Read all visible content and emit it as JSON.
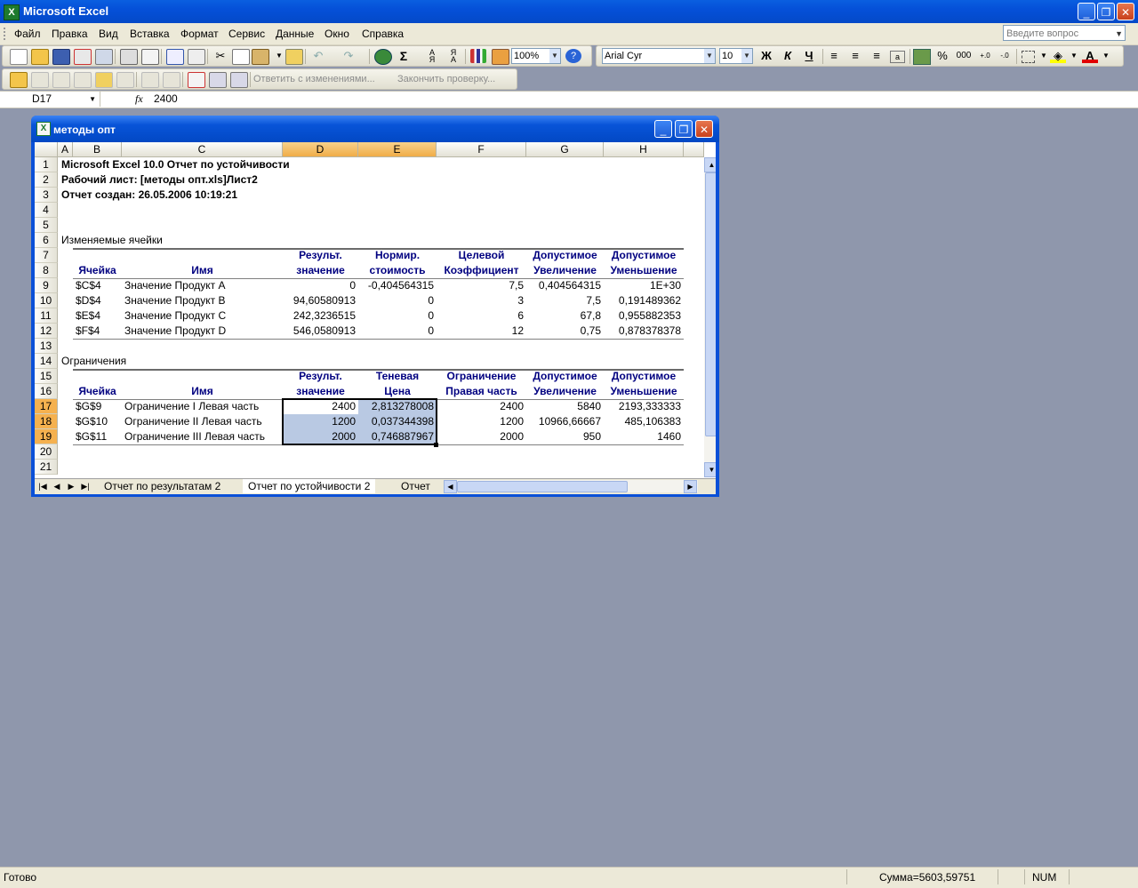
{
  "app": {
    "title": "Microsoft Excel"
  },
  "menu": [
    "Файл",
    "Правка",
    "Вид",
    "Вставка",
    "Формат",
    "Сервис",
    "Данные",
    "Окно",
    "Справка"
  ],
  "ask_placeholder": "Введите вопрос",
  "standard_toolbar": {
    "zoom": "100%"
  },
  "formatting_toolbar": {
    "font": "Arial Cyr",
    "size": "10",
    "bold": "Ж",
    "italic": "К",
    "underline": "Ч",
    "percent": "%",
    "thousands": "000"
  },
  "review_toolbar": {
    "reply_label": "Ответить с изменениями...",
    "end_label": "Закончить проверку..."
  },
  "formula_bar": {
    "name_box": "D17",
    "fx": "fx",
    "value": "2400"
  },
  "workbook": {
    "title": "методы опт",
    "columns": [
      "A",
      "B",
      "C",
      "D",
      "E",
      "F",
      "G",
      "H"
    ],
    "rows": [
      "1",
      "2",
      "3",
      "4",
      "5",
      "6",
      "7",
      "8",
      "9",
      "10",
      "11",
      "12",
      "13",
      "14",
      "15",
      "16",
      "17",
      "18",
      "19",
      "20",
      "21"
    ],
    "report": {
      "line1": "Microsoft Excel 10.0 Отчет по устойчивости",
      "line2": "Рабочий лист: [методы опт.xls]Лист2",
      "line3": "Отчет создан: 26.05.2006 10:19:21"
    },
    "changing_cells": {
      "section_title": "Изменяемые ячейки",
      "headers_top": [
        "",
        "",
        "Результ.",
        "Нормир.",
        "Целевой",
        "Допустимое",
        "Допустимое"
      ],
      "headers_bottom": [
        "Ячейка",
        "Имя",
        "значение",
        "стоимость",
        "Коэффициент",
        "Увеличение",
        "Уменьшение"
      ],
      "rows": [
        [
          "$C$4",
          "Значение Продукт A",
          "0",
          "-0,404564315",
          "7,5",
          "0,404564315",
          "1E+30"
        ],
        [
          "$D$4",
          "Значение Продукт B",
          "94,60580913",
          "0",
          "3",
          "7,5",
          "0,191489362"
        ],
        [
          "$E$4",
          "Значение Продукт C",
          "242,3236515",
          "0",
          "6",
          "67,8",
          "0,955882353"
        ],
        [
          "$F$4",
          "Значение Продукт D",
          "546,0580913",
          "0",
          "12",
          "0,75",
          "0,878378378"
        ]
      ]
    },
    "constraints": {
      "section_title": "Ограничения",
      "headers_top": [
        "",
        "",
        "Результ.",
        "Теневая",
        "Ограничение",
        "Допустимое",
        "Допустимое"
      ],
      "headers_bottom": [
        "Ячейка",
        "Имя",
        "значение",
        "Цена",
        "Правая часть",
        "Увеличение",
        "Уменьшение"
      ],
      "rows": [
        [
          "$G$9",
          "Ограничение I Левая часть",
          "2400",
          "2,813278008",
          "2400",
          "5840",
          "2193,333333"
        ],
        [
          "$G$10",
          "Ограничение II Левая часть",
          "1200",
          "0,037344398",
          "1200",
          "10966,66667",
          "485,106383"
        ],
        [
          "$G$11",
          "Ограничение III Левая часть",
          "2000",
          "0,746887967",
          "2000",
          "950",
          "1460"
        ]
      ]
    },
    "tabs": [
      "Отчет по результатам 2",
      "Отчет по устойчивости 2",
      "Отчет"
    ]
  },
  "status": {
    "ready": "Готово",
    "sum": "Сумма=5603,59751",
    "num": "NUM"
  }
}
